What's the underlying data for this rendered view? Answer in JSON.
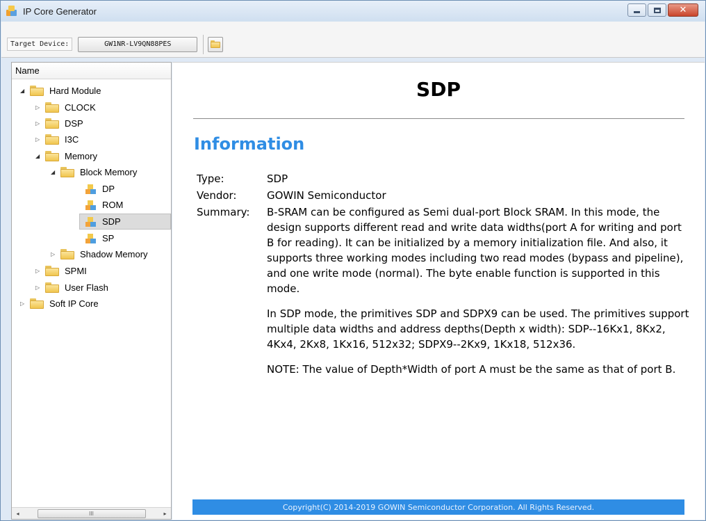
{
  "window": {
    "title": "IP Core Generator",
    "controls": {
      "minimize": "minimize",
      "maximize": "maximize",
      "close": "✕"
    }
  },
  "toolbar": {
    "target_device_label": "Target Device:",
    "device_value": "GW1NR-LV9QN88PES",
    "open_icon": "folder-icon"
  },
  "tree": {
    "header": "Name",
    "items": [
      {
        "label": "Hard Module",
        "arrow": "◢",
        "icon": "folder"
      },
      {
        "label": "CLOCK",
        "arrow": "▷",
        "icon": "folder"
      },
      {
        "label": "DSP",
        "arrow": "▷",
        "icon": "folder"
      },
      {
        "label": "I3C",
        "arrow": "▷",
        "icon": "folder"
      },
      {
        "label": "Memory",
        "arrow": "◢",
        "icon": "folder"
      },
      {
        "label": "Block Memory",
        "arrow": "◢",
        "icon": "folder"
      },
      {
        "label": "DP",
        "arrow": "",
        "icon": "ip-core"
      },
      {
        "label": "ROM",
        "arrow": "",
        "icon": "ip-core"
      },
      {
        "label": "SDP",
        "arrow": "",
        "icon": "ip-core",
        "selected": true
      },
      {
        "label": "SP",
        "arrow": "",
        "icon": "ip-core"
      },
      {
        "label": "Shadow Memory",
        "arrow": "▷",
        "icon": "folder"
      },
      {
        "label": "SPMI",
        "arrow": "▷",
        "icon": "folder"
      },
      {
        "label": "User Flash",
        "arrow": "▷",
        "icon": "folder"
      },
      {
        "label": "Soft IP Core",
        "arrow": "▷",
        "icon": "folder"
      }
    ],
    "scroll": {
      "left": "◂",
      "right": "▸",
      "thumb": "III"
    }
  },
  "content": {
    "title": "SDP",
    "section": "Information",
    "type_key": "Type:",
    "type_value": "SDP",
    "vendor_key": "Vendor:",
    "vendor_value": "GOWIN Semiconductor",
    "summary_key": "Summary:",
    "summary_p1": "B-SRAM can be configured as Semi dual-port Block SRAM. In this mode, the design supports different read and write data widths(port A for writing and port B for reading). It can be initialized by a memory initialization file. And also, it supports three working modes including two read modes (bypass and pipeline), and one write mode (normal). The byte enable function is supported in this mode.",
    "summary_p2": "In SDP mode, the primitives SDP and SDPX9 can be used. The primitives support multiple data widths and address depths(Depth x width): SDP--16Kx1, 8Kx2, 4Kx4, 2Kx8, 1Kx16, 512x32; SDPX9--2Kx9, 1Kx18, 512x36.",
    "summary_p3": "NOTE: The value of Depth*Width of port A must be the same as that of port B.",
    "footer": "Copyright(C) 2014-2019 GOWIN Semiconductor Corporation. All Rights Reserved."
  },
  "colors": {
    "accent": "#2f8de4",
    "selection": "#dcdcdc",
    "folder": "#f1c54e"
  }
}
